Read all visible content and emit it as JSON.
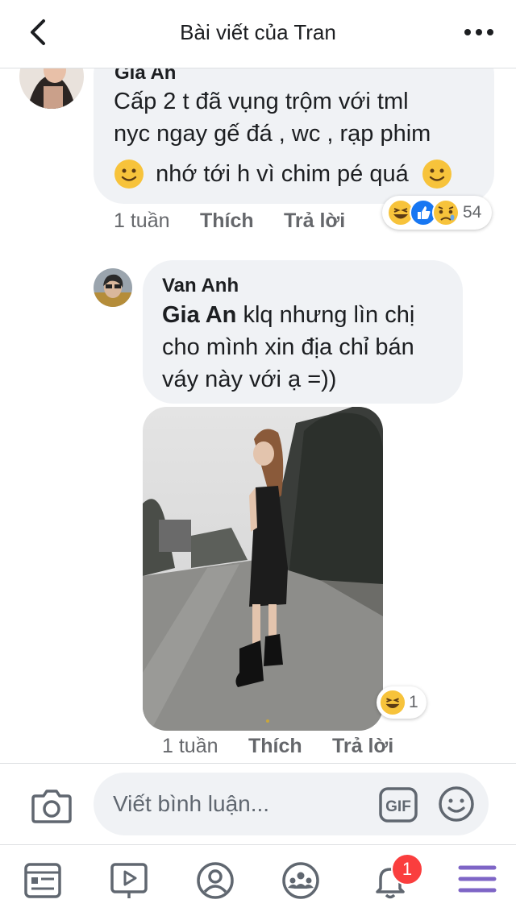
{
  "header": {
    "title": "Bài viết của Tran"
  },
  "comment_top": {
    "author": "Gia An",
    "lines": [
      "Cấp 2 t đã vụng trộm với tml",
      "nyc ngay gế đá , wc , rạp phim",
      "nhớ tới h vì chim pé quá"
    ],
    "time": "1 tuần",
    "like_label": "Thích",
    "reply_label": "Trả lời",
    "reaction_count": "54"
  },
  "reply": {
    "author": "Van Anh",
    "mention": "Gia An",
    "line1_rest": " klq nhưng lìn chị",
    "lines": [
      "cho mình xin địa chỉ bán",
      "váy này với ạ =))"
    ],
    "time": "1 tuần",
    "like_label": "Thích",
    "reply_label": "Trả lời",
    "photo_reaction_count": "1"
  },
  "composer": {
    "placeholder": "Viết bình luận...",
    "gif_label": "GIF"
  },
  "nav": {
    "notification_badge": "1",
    "active_color": "#7e65c6"
  },
  "colors": {
    "bubble": "#f0f2f5",
    "like_blue": "#1877f2",
    "emoji_yellow": "#f7c33b",
    "badge_red": "#fa3e3e"
  }
}
